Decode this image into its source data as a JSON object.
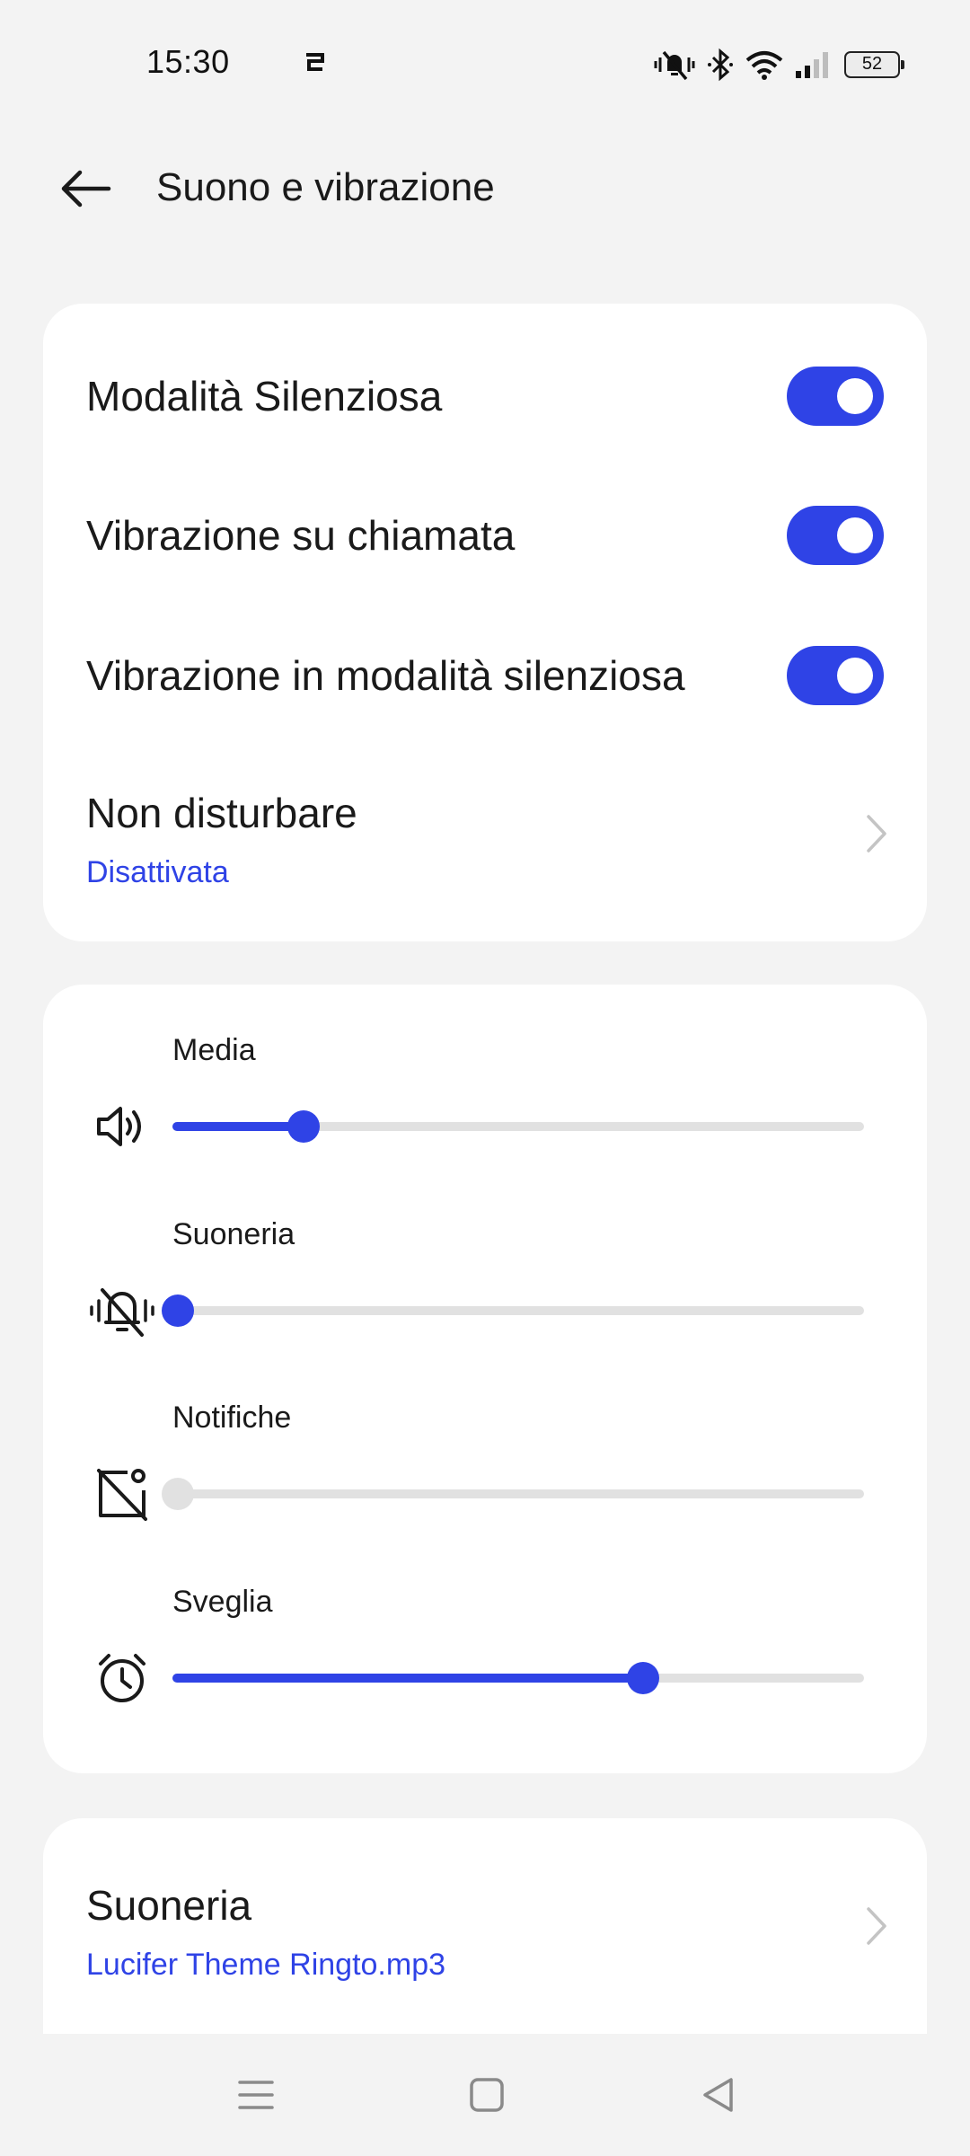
{
  "status_bar": {
    "time": "15:30",
    "battery": "52",
    "icons": [
      "notification-icon",
      "vibrate-mute-icon",
      "bluetooth-icon",
      "wifi-icon",
      "signal-icon",
      "battery-icon"
    ]
  },
  "header": {
    "title": "Suono e vibrazione",
    "back_icon": "arrow-left-icon"
  },
  "toggles": [
    {
      "label": "Modalità Silenziosa",
      "enabled": true
    },
    {
      "label": "Vibrazione su chiamata",
      "enabled": true
    },
    {
      "label": "Vibrazione in modalità silenziosa",
      "enabled": true
    }
  ],
  "do_not_disturb": {
    "title": "Non disturbare",
    "status": "Disattivata"
  },
  "volumes": [
    {
      "label": "Media",
      "icon": "speaker-icon",
      "level": 0.19,
      "enabled": true
    },
    {
      "label": "Suoneria",
      "icon": "ringer-muted-icon",
      "level": 0.0,
      "enabled": true
    },
    {
      "label": "Notifiche",
      "icon": "notification-muted-icon",
      "level": 0.0,
      "enabled": false
    },
    {
      "label": "Sveglia",
      "icon": "alarm-clock-icon",
      "level": 0.68,
      "enabled": true
    }
  ],
  "ringtone": {
    "title": "Suoneria",
    "value": "Lucifer Theme Ringto.mp3"
  },
  "navigation": {
    "icons": [
      "menu-icon",
      "home-icon",
      "back-triangle-icon"
    ]
  },
  "colors": {
    "accent": "#2f43e6",
    "background": "#f3f3f3",
    "card": "#ffffff",
    "track": "#e1e1e1"
  }
}
